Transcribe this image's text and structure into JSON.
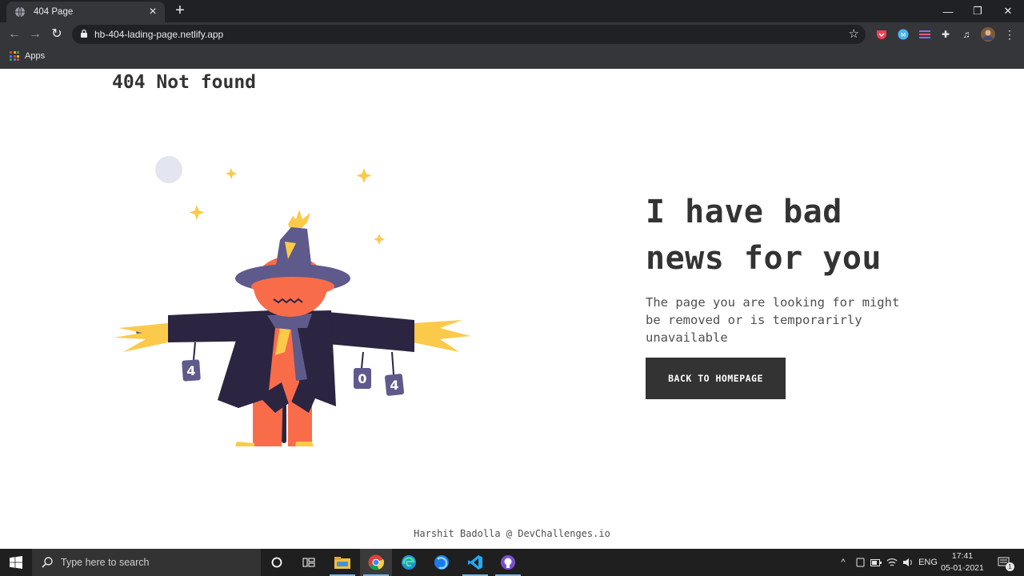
{
  "browser": {
    "tab_title": "404 Page",
    "tab_close": "×",
    "new_tab": "+",
    "url": "hb-404-lading-page.netlify.app",
    "bookmarks_apps": "Apps",
    "window_controls": [
      "—",
      "❐",
      "✕"
    ],
    "extensions": [
      "pocket-icon",
      "extension-blue-icon",
      "extension-stack-icon",
      "puzzle-icon",
      "media-icon",
      "avatar"
    ]
  },
  "page": {
    "title": "404 Not found",
    "headline": "I have bad news for you",
    "lead": "The page you are looking for might be removed or is temporarirly unavailable",
    "cta_label": "BACK TO HOMEPAGE",
    "footer": "Harshit Badolla @ DevChallenges.io",
    "sign_letters": [
      "4",
      "0",
      "4"
    ]
  },
  "taskbar": {
    "search_placeholder": "Type here to search",
    "tray_language": "ENG",
    "time": "17:41",
    "date": "05-01-2021",
    "notification_count": "1"
  },
  "colors": {
    "text_dark": "#333333",
    "text_body": "#4f4f4f",
    "button_bg": "#333333",
    "scarecrow_hat": "#5e5a8c",
    "scarecrow_coat": "#2b2541",
    "scarecrow_head": "#f96c4a",
    "straw": "#fcca4a"
  }
}
